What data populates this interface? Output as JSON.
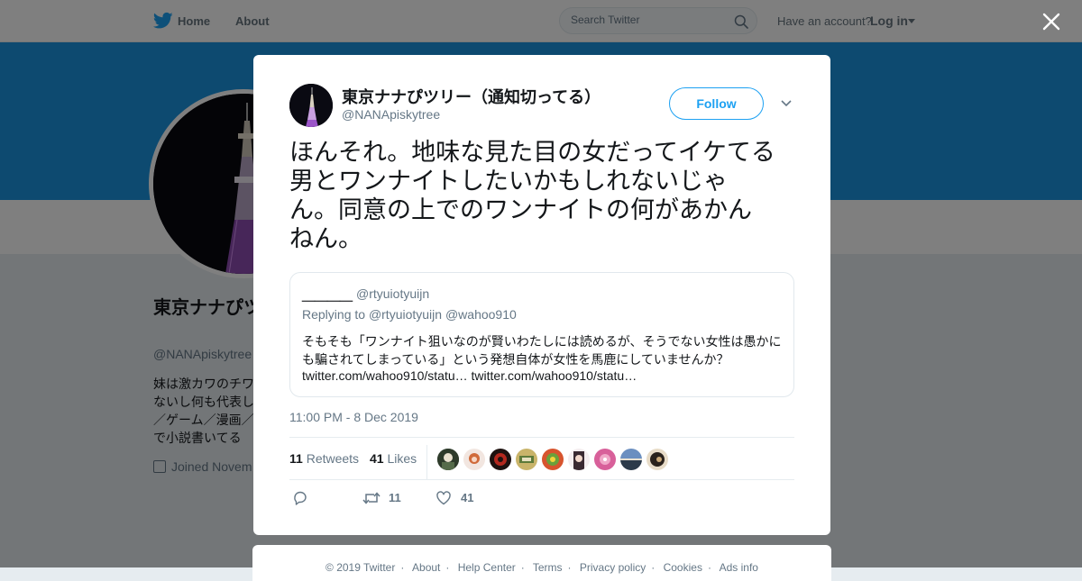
{
  "topbar": {
    "home_label": "Home",
    "about_label": "About",
    "search_placeholder": "Search Twitter",
    "account_prompt": "Have an account?",
    "login_label": "Log in"
  },
  "profile": {
    "name": "東京ナナぴツリー（通知切ってる）",
    "handle": "@NANApiskytree",
    "bio": "妹は激カワのチワ\nないし何も代表し\n／ゲーム／漫画／\nで小説書いてる",
    "joined": "Joined Novem"
  },
  "tweet": {
    "author_name": "東京ナナぴツリー（通知切ってる）",
    "author_handle": "@NANApiskytree",
    "follow_label": "Follow",
    "text": "ほんそれ。地味な見た目の女だってイケてる\n男とワンナイトしたいかもしれないじゃ\nん。同意の上でのワンナイトの何があかん\nねん。",
    "quote": {
      "name": "＿＿＿＿",
      "handle": "@rtyuiotyuijn",
      "reply_prefix": "Replying to",
      "reply_to_1": "@rtyuiotyuijn",
      "reply_to_2": "@wahoo910",
      "text": "そもそも「ワンナイト狙いなのが賢いわたしには読めるが、そうでない女性は愚かにも騙されてしまっている」という発想自体が女性を馬鹿にしていませんか？",
      "link_1": "twitter.com/wahoo910/statu…",
      "link_2": "twitter.com/wahoo910/statu…"
    },
    "timestamp": "11:00 PM - 8 Dec 2019",
    "retweets_count": "11",
    "retweets_label": "Retweets",
    "likes_count": "41",
    "likes_label": "Likes",
    "action_retweet_count": "11",
    "action_like_count": "41"
  },
  "footer": {
    "links": [
      "© 2019 Twitter",
      "About",
      "Help Center",
      "Terms",
      "Privacy policy",
      "Cookies",
      "Ads info"
    ]
  },
  "colors": {
    "brand": "#1da1f2",
    "banner": "#1b95e0",
    "muted": "#657786"
  },
  "icons": [
    "twitter-bird-icon",
    "search-icon",
    "close-icon",
    "chevron-down-icon",
    "reply-icon",
    "retweet-icon",
    "heart-icon",
    "calendar-icon"
  ]
}
